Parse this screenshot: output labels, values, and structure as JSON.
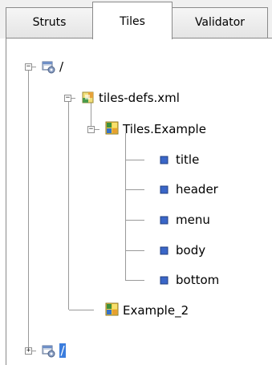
{
  "tabs": [
    {
      "label": "Struts",
      "selected": false
    },
    {
      "label": "Tiles",
      "selected": true
    },
    {
      "label": "Validator",
      "selected": false
    }
  ],
  "tree": {
    "root": {
      "label": "/",
      "expanded": true,
      "icon": "web-module-icon",
      "children": {
        "defs_file": {
          "label": "tiles-defs.xml",
          "expanded": true,
          "icon": "xml-file-icon",
          "definitions": [
            {
              "label": "Tiles.Example",
              "expanded": true,
              "icon": "tiles-definition-icon",
              "attributes": [
                {
                  "label": "title",
                  "icon": "attribute-icon"
                },
                {
                  "label": "header",
                  "icon": "attribute-icon"
                },
                {
                  "label": "menu",
                  "icon": "attribute-icon"
                },
                {
                  "label": "body",
                  "icon": "attribute-icon"
                },
                {
                  "label": "bottom",
                  "icon": "attribute-icon"
                }
              ]
            },
            {
              "label": "Example_2",
              "icon": "tiles-definition-icon"
            }
          ]
        }
      }
    },
    "second_root": {
      "label": "/",
      "expanded": false,
      "selected": true,
      "icon": "web-module-icon"
    }
  },
  "colors": {
    "selection": "#3b7ddd",
    "attribute_square": "#3a66c8",
    "tab_border": "#8a8a8a",
    "tree_line": "#9a9a9a"
  }
}
